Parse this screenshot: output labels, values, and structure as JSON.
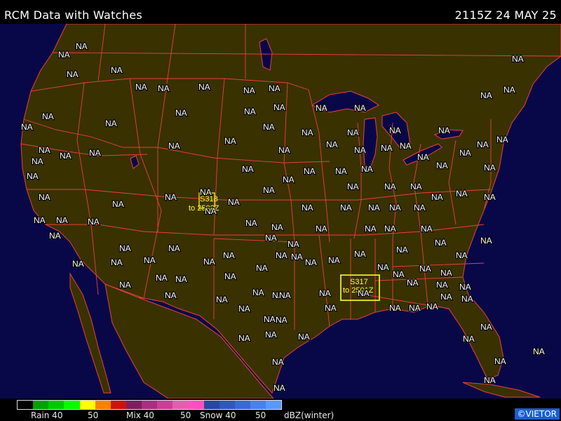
{
  "header": {
    "title": "RCM Data with Watches",
    "timestamp": "2115Z 24 MAY 25"
  },
  "colors": {
    "land": "#3a3100",
    "water": "#080848",
    "boundary": "#e8413b",
    "watch": "#ffff33"
  },
  "station_label": "NA",
  "watches": [
    {
      "id": "S318",
      "expires": "to 2502Z"
    },
    {
      "id": "S317",
      "expires": "to 2501Z"
    }
  ],
  "legend": {
    "swatches": [
      "#000000",
      "#00a000",
      "#00c800",
      "#00ff00",
      "#ffff00",
      "#ff8000",
      "#d01010",
      "#7a2060",
      "#a83080",
      "#c84098",
      "#e060b0",
      "#ff50c0",
      "#2848a0",
      "#3058b8",
      "#3a6ad0",
      "#4a80e8",
      "#5a98ff"
    ],
    "rain": "Rain 40",
    "rain50": "50",
    "mix": "Mix 40",
    "mix50": "50",
    "snow": "Snow 40",
    "snow50": "50",
    "units": "dBZ(winter)"
  },
  "copyright": "©VIETOR"
}
